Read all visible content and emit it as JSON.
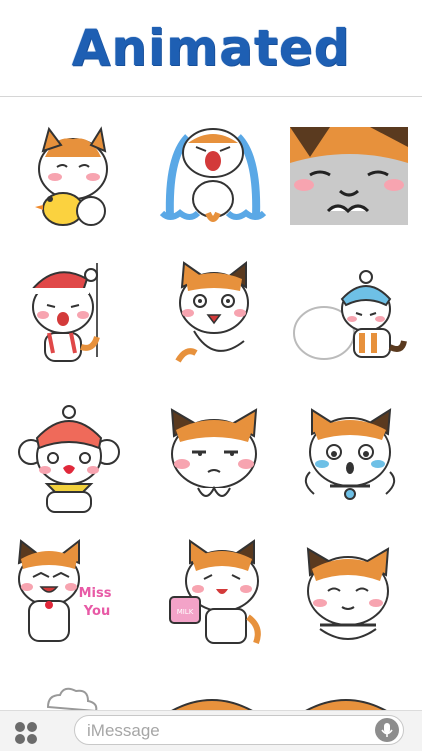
{
  "header": {
    "title": "Animated"
  },
  "stickers": [
    {
      "name": "cat-hugging-duck"
    },
    {
      "name": "cat-crying"
    },
    {
      "name": "cat-closeup-smug"
    },
    {
      "name": "cat-santa-hat"
    },
    {
      "name": "cat-shocked"
    },
    {
      "name": "cat-blue-hat-pushing"
    },
    {
      "name": "cat-winter-hat-love"
    },
    {
      "name": "cat-annoyed"
    },
    {
      "name": "cat-teary"
    },
    {
      "name": "cat-miss-you",
      "text": "Miss You"
    },
    {
      "name": "cat-milk-mug",
      "text": "MILK"
    },
    {
      "name": "cat-content"
    }
  ],
  "input": {
    "placeholder": "iMessage"
  },
  "icons": {
    "apps": "apps-grid-icon",
    "mic": "microphone-icon"
  },
  "colors": {
    "title": "#1e5fb3",
    "fur_orange": "#e7913c",
    "fur_dark": "#5a3a1f",
    "blush": "#f7a4b0"
  }
}
